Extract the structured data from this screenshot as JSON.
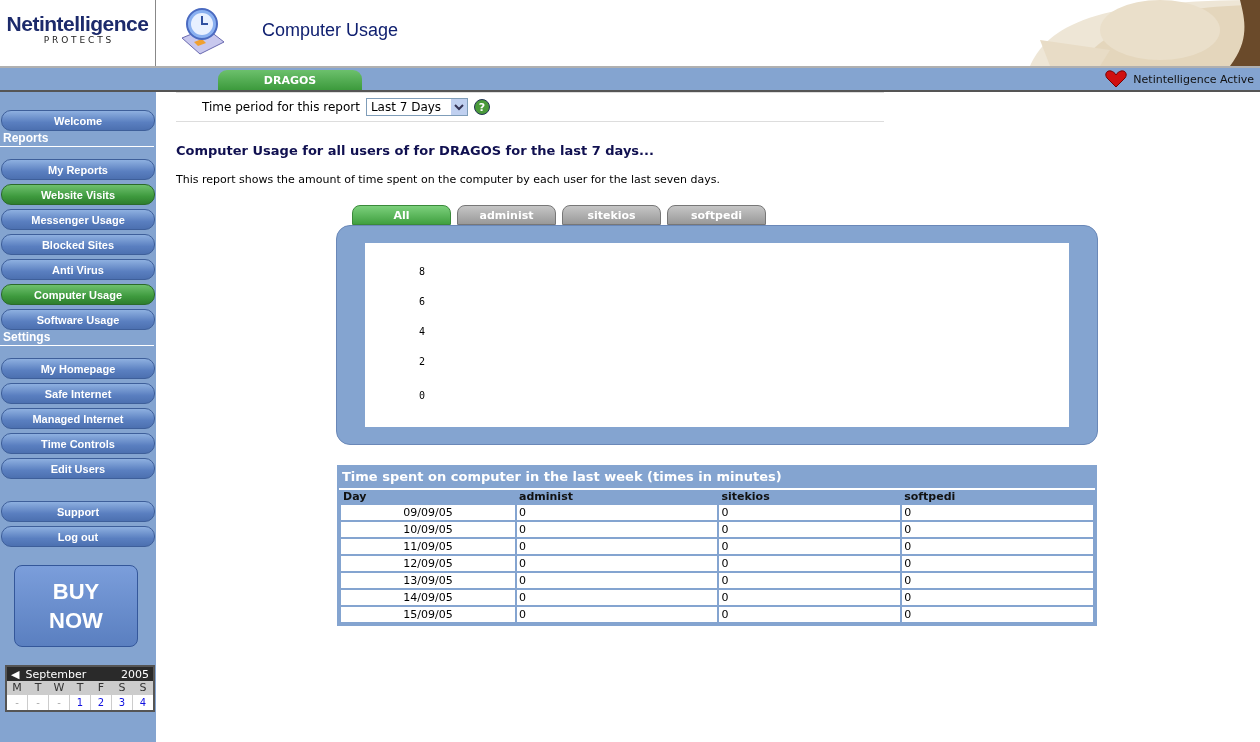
{
  "header": {
    "logo": {
      "name": "Netintelligence",
      "tagline": "P R O T E C T S"
    },
    "title": "Computer Usage"
  },
  "tab_bar": {
    "tabs": [
      {
        "label": "DRAGOS",
        "selected": true
      }
    ],
    "status": "Netintelligence Active"
  },
  "sidebar": {
    "items": [
      {
        "kind": "button",
        "label": "Welcome",
        "selected": false
      },
      {
        "kind": "heading",
        "label": "Reports"
      },
      {
        "kind": "button",
        "label": "My Reports",
        "selected": false
      },
      {
        "kind": "button",
        "label": "Website Visits",
        "selected": true
      },
      {
        "kind": "button",
        "label": "Messenger Usage",
        "selected": false
      },
      {
        "kind": "button",
        "label": "Blocked Sites",
        "selected": false
      },
      {
        "kind": "button",
        "label": "Anti Virus",
        "selected": false
      },
      {
        "kind": "button",
        "label": "Computer Usage",
        "selected": true
      },
      {
        "kind": "button",
        "label": "Software Usage",
        "selected": false
      },
      {
        "kind": "heading",
        "label": "Settings"
      },
      {
        "kind": "button",
        "label": "My Homepage",
        "selected": false
      },
      {
        "kind": "button",
        "label": "Safe Internet",
        "selected": false
      },
      {
        "kind": "button",
        "label": "Managed Internet",
        "selected": false
      },
      {
        "kind": "button",
        "label": "Time Controls",
        "selected": false
      },
      {
        "kind": "button",
        "label": "Edit Users",
        "selected": false
      },
      {
        "kind": "gap"
      },
      {
        "kind": "button",
        "label": "Support",
        "selected": false
      },
      {
        "kind": "button",
        "label": "Log out",
        "selected": false
      }
    ],
    "buy_button": {
      "line_1": "BUY",
      "line_2": "NOW"
    },
    "calendar": {
      "prev": "◀",
      "month": "September",
      "year": "2005",
      "weekdays": [
        "M",
        "T",
        "W",
        "T",
        "F",
        "S",
        "S"
      ],
      "days": [
        {
          "label": "-",
          "in_month": false
        },
        {
          "label": "-",
          "in_month": false
        },
        {
          "label": "-",
          "in_month": false
        },
        {
          "label": "1",
          "in_month": true
        },
        {
          "label": "2",
          "in_month": true
        },
        {
          "label": "3",
          "in_month": true
        },
        {
          "label": "4",
          "in_month": true
        }
      ]
    }
  },
  "period": {
    "label": "Time period for this report",
    "value": "Last 7 Days",
    "help": "?"
  },
  "report": {
    "heading": "Computer Usage for all users of for DRAGOS for the last 7 days...",
    "description": "This report shows the amount of time spent on the computer by each user for the last seven days."
  },
  "user_tabs": [
    {
      "label": "All",
      "selected": true
    },
    {
      "label": "administ",
      "selected": false
    },
    {
      "label": "sitekios",
      "selected": false
    },
    {
      "label": "softpedi",
      "selected": false
    }
  ],
  "chart": {
    "axis_labels": [
      "8",
      "6",
      "4",
      "2",
      "0"
    ]
  },
  "table": {
    "title": "Time spent on computer in the last week (times in minutes)",
    "columns": [
      "Day",
      "administ",
      "sitekios",
      "softpedi"
    ],
    "rows": [
      [
        "09/09/05",
        "0",
        "0",
        "0"
      ],
      [
        "10/09/05",
        "0",
        "0",
        "0"
      ],
      [
        "11/09/05",
        "0",
        "0",
        "0"
      ],
      [
        "12/09/05",
        "0",
        "0",
        "0"
      ],
      [
        "13/09/05",
        "0",
        "0",
        "0"
      ],
      [
        "14/09/05",
        "0",
        "0",
        "0"
      ],
      [
        "15/09/05",
        "0",
        "0",
        "0"
      ]
    ]
  }
}
